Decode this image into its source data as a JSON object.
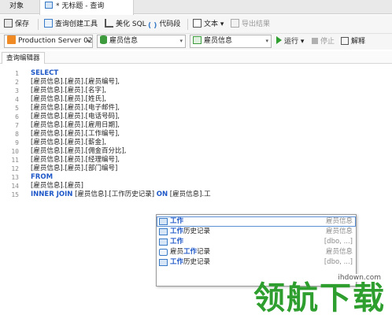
{
  "tabs": {
    "objects_label": "对象",
    "query_label": "* 无标题 - 查询"
  },
  "toolbar": {
    "save": "保存",
    "query_builder": "查询创建工具",
    "beautify_sql": "美化 SQL",
    "code_snippet": "代码段",
    "text": "文本",
    "export_result": "导出结果",
    "code_icon_glyph": "( )",
    "dropdown_glyph": "▾"
  },
  "connection_bar": {
    "server": "Production Server 02",
    "database": "雇员信息",
    "schema": "雇员信息",
    "run": "运行",
    "stop": "停止",
    "explain": "解释"
  },
  "editor": {
    "subtab": "查询编辑器",
    "lines": [
      {
        "n": "1",
        "kw": "SELECT",
        "text": ""
      },
      {
        "n": "2",
        "kw": "",
        "text": "[雇员信息].[雇员].[雇员编号],"
      },
      {
        "n": "3",
        "kw": "",
        "text": "[雇员信息].[雇员].[名字],"
      },
      {
        "n": "4",
        "kw": "",
        "text": "[雇员信息].[雇员].[姓氏],"
      },
      {
        "n": "5",
        "kw": "",
        "text": "[雇员信息].[雇员].[电子邮件],"
      },
      {
        "n": "6",
        "kw": "",
        "text": "[雇员信息].[雇员].[电话号码],"
      },
      {
        "n": "7",
        "kw": "",
        "text": "[雇员信息].[雇员].[雇用日期],"
      },
      {
        "n": "8",
        "kw": "",
        "text": "[雇员信息].[雇员].[工作编号],"
      },
      {
        "n": "9",
        "kw": "",
        "text": "[雇员信息].[雇员].[薪金],"
      },
      {
        "n": "10",
        "kw": "",
        "text": "[雇员信息].[雇员].[佣金百分比],"
      },
      {
        "n": "11",
        "kw": "",
        "text": "[雇员信息].[雇员].[经理编号],"
      },
      {
        "n": "12",
        "kw": "",
        "text": "[雇员信息].[雇员].[部门编号]"
      },
      {
        "n": "13",
        "kw": "FROM",
        "text": ""
      },
      {
        "n": "14",
        "kw": "",
        "text": "[雇员信息].[雇员]"
      },
      {
        "n": "15",
        "kw": "INNER JOIN",
        "text": "[雇员信息].[工作历史记录]",
        "kw2": "ON",
        "text2": "[雇员信息].工"
      }
    ]
  },
  "autocomplete": {
    "items": [
      {
        "pre": "",
        "hl": "工作",
        "post": "",
        "schema": "雇员信息",
        "kind": "table"
      },
      {
        "pre": "",
        "hl": "工作",
        "post": "历史记录",
        "schema": "雇员信息",
        "kind": "table"
      },
      {
        "pre": "",
        "hl": "工作",
        "post": "",
        "schema": "[dbo, ...]",
        "kind": "table"
      },
      {
        "pre": "雇员",
        "hl": "工作",
        "post": "记录",
        "schema": "雇员信息",
        "kind": "view"
      },
      {
        "pre": "",
        "hl": "工作",
        "post": "历史记录",
        "schema": "[dbo, ...]",
        "kind": "table"
      }
    ]
  },
  "watermark": {
    "url": "ihdown.com",
    "text": "领航下载"
  }
}
